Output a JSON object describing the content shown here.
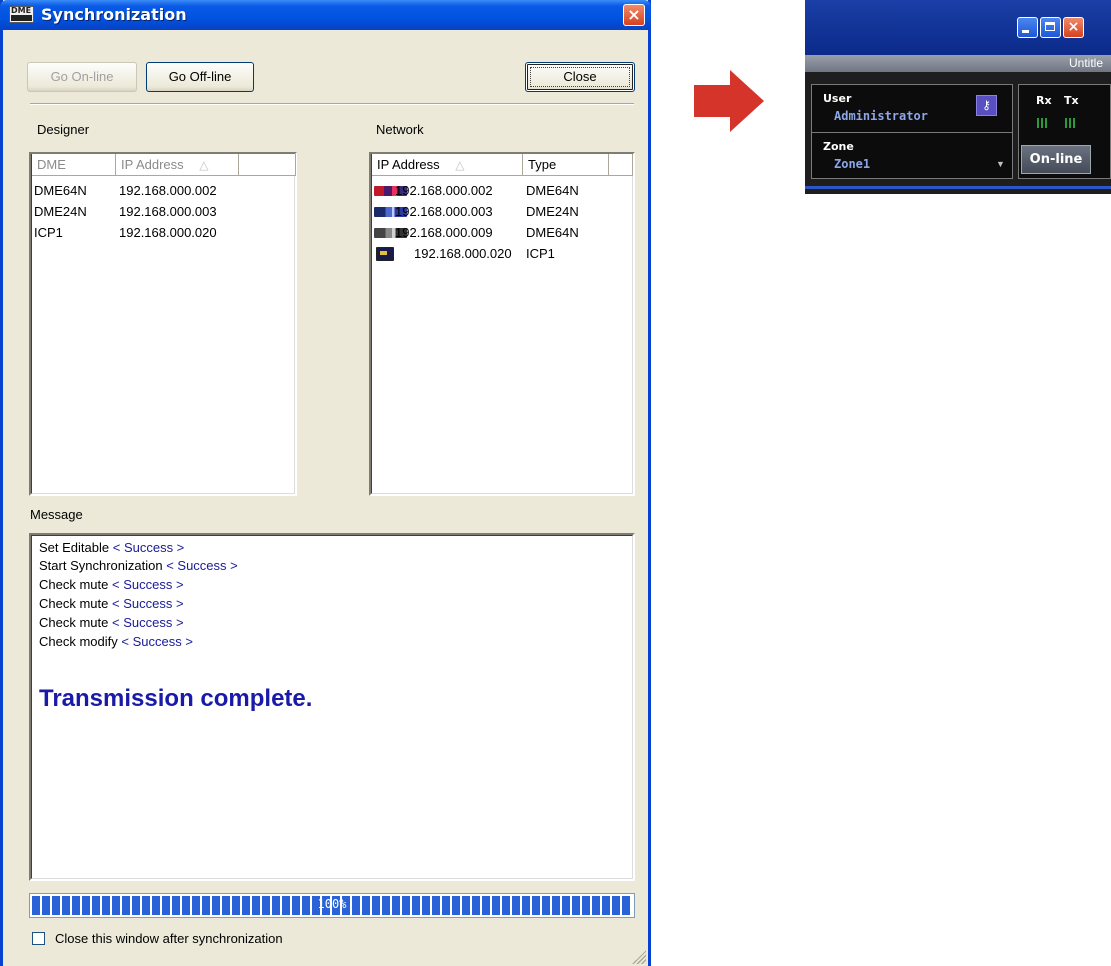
{
  "dialog": {
    "title": "Synchronization",
    "close_glyph": "×",
    "app_icon_text": "DME",
    "buttons": {
      "go_online": "Go On-line",
      "go_offline": "Go Off-line",
      "close": "Close"
    },
    "designer": {
      "label": "Designer",
      "columns": [
        "DME",
        "IP Address"
      ],
      "sort_indicator": "△",
      "rows": [
        {
          "dme": "DME64N",
          "ip": "192.168.000.002"
        },
        {
          "dme": "DME24N",
          "ip": "192.168.000.003"
        },
        {
          "dme": "ICP1",
          "ip": "192.168.000.020"
        }
      ]
    },
    "network": {
      "label": "Network",
      "columns": [
        "IP Address",
        "Type"
      ],
      "sort_indicator": "△",
      "rows": [
        {
          "icon": "dme64n-red-device-icon",
          "ip": "192.168.000.002",
          "type": "DME64N"
        },
        {
          "icon": "dme24n-blue-device-icon",
          "ip": "192.168.000.003",
          "type": "DME24N"
        },
        {
          "icon": "dme64n-gray-device-icon",
          "ip": "192.168.000.009",
          "type": "DME64N"
        },
        {
          "icon": "icp1-device-icon",
          "ip": "192.168.000.020",
          "type": "ICP1"
        }
      ]
    },
    "message": {
      "label": "Message",
      "lines": [
        {
          "text": "Set Editable",
          "status": "< Success >"
        },
        {
          "text": "Start Synchronization",
          "status": "< Success >"
        },
        {
          "text": "Check mute",
          "status": "< Success >"
        },
        {
          "text": "Check mute",
          "status": "< Success >"
        },
        {
          "text": "Check mute",
          "status": "< Success >"
        },
        {
          "text": "Check modify",
          "status": "< Success >"
        }
      ],
      "result": "Transmission complete."
    },
    "progress": {
      "value": 1.0,
      "label": "100%"
    },
    "checkbox": {
      "label": "Close this window after synchronization",
      "checked": false
    }
  },
  "panel": {
    "window_title": "Untitle",
    "close_glyph": "×",
    "user": {
      "label": "User",
      "value": "Administrator"
    },
    "zone": {
      "label": "Zone",
      "value": "Zone1"
    },
    "rx_label": "Rx",
    "tx_label": "Tx",
    "online_button": "On-line",
    "key_glyph": "⚷",
    "dropdown_glyph": "▼"
  },
  "colors": {
    "titlebar_blue": "#0053e0",
    "success_text": "#1a1a9a",
    "result_text": "#1a1aa8",
    "arrow_red": "#d4342a",
    "progress_blue": "#2a62d8"
  }
}
